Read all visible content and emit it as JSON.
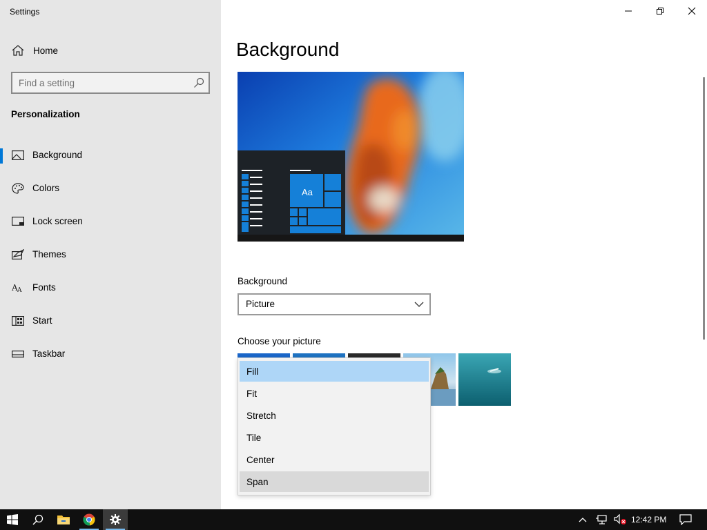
{
  "window": {
    "title": "Settings",
    "controls": {
      "minimize": "minimize",
      "restore": "restore",
      "close": "close"
    }
  },
  "sidebar": {
    "home_label": "Home",
    "search_placeholder": "Find a setting",
    "section_title": "Personalization",
    "items": [
      {
        "label": "Background",
        "icon": "picture-icon",
        "active": true
      },
      {
        "label": "Colors",
        "icon": "palette-icon",
        "active": false
      },
      {
        "label": "Lock screen",
        "icon": "lock-screen-icon",
        "active": false
      },
      {
        "label": "Themes",
        "icon": "themes-icon",
        "active": false
      },
      {
        "label": "Fonts",
        "icon": "fonts-icon",
        "active": false
      },
      {
        "label": "Start",
        "icon": "start-icon",
        "active": false
      },
      {
        "label": "Taskbar",
        "icon": "taskbar-icon",
        "active": false
      }
    ]
  },
  "main": {
    "title": "Background",
    "preview": {
      "tile_text": "Aa"
    },
    "background_label": "Background",
    "background_value": "Picture",
    "choose_picture_label": "Choose your picture"
  },
  "fit_dropdown": {
    "options": [
      "Fill",
      "Fit",
      "Stretch",
      "Tile",
      "Center",
      "Span"
    ],
    "selected": "Fill",
    "hovered": "Span"
  },
  "taskbar": {
    "apps": [
      "start-button",
      "search-button",
      "file-explorer",
      "chrome",
      "settings"
    ],
    "clock": "12:42 PM"
  },
  "colors": {
    "accent": "#0078d7",
    "sidebar_bg": "#e6e6e6",
    "selected_option": "#aed6f7",
    "taskbar_bg": "#101010"
  }
}
